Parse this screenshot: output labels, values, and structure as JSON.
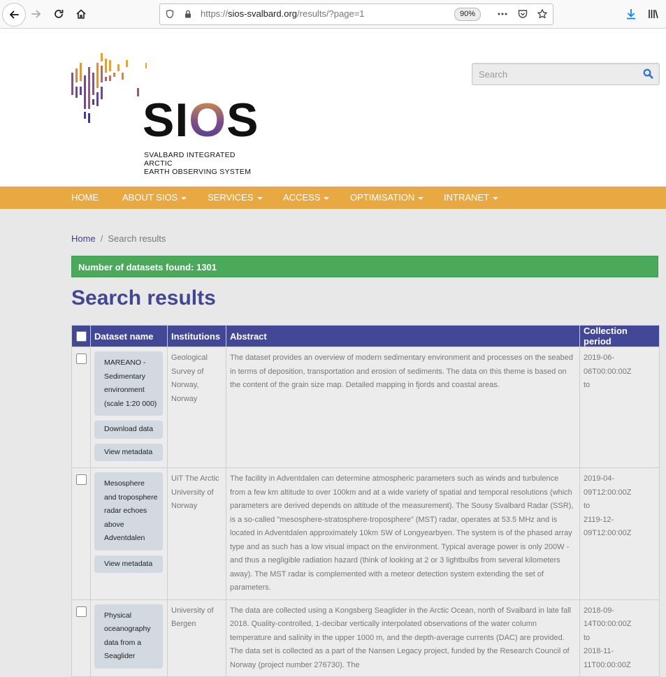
{
  "browser": {
    "url_prefix": "https://",
    "url_host": "sios-svalbard.org",
    "url_path": "/results/?page=1",
    "zoom": "90%"
  },
  "header": {
    "logo_word": "SIOS",
    "logo_sub_line1": "SVALBARD INTEGRATED ARCTIC",
    "logo_sub_line2": "EARTH OBSERVING SYSTEM",
    "search_placeholder": "Search"
  },
  "menu": {
    "items": [
      {
        "label": "HOME"
      },
      {
        "label": "ABOUT SIOS"
      },
      {
        "label": "SERVICES"
      },
      {
        "label": "ACCESS"
      },
      {
        "label": "OPTIMISATION"
      },
      {
        "label": "INTRANET"
      }
    ]
  },
  "breadcrumb": {
    "home": "Home",
    "separator": "/",
    "current": "Search results"
  },
  "alert": {
    "text": "Number of datasets found: 1301"
  },
  "page_title": "Search results",
  "table": {
    "headers": {
      "dataset": "Dataset name",
      "institutions": "Institutions",
      "abstract": "Abstract",
      "period": "Collection period"
    },
    "rows": [
      {
        "name": "MAREANO - Sedimentary environment (scale 1:20 000)",
        "download": "Download data",
        "metadata": "View metadata",
        "institution": "Geological Survey of Norway, Norway",
        "abstract": "The dataset provides an overview of modern sedimentary environment and processes on the seabed in terms of deposition, transportation and erosion of sediments. The data on this theme is based on the content of the grain size map. Detailed mapping in fjords and coastal areas.",
        "period_start": "2019-06-06T00:00:00Z",
        "period_to": "to",
        "period_end": ""
      },
      {
        "name": "Mesosphere and troposphere radar echoes above Adventdalen",
        "metadata": "View metadata",
        "institution": "UiT The Arctic University of Norway",
        "abstract": "The facility in Adventdalen can determine atmospheric parameters such as winds and turbulence from a few km altitude to over 100km and at a wide variety of spatial and temporal resolutions (which parameters are derived depends on altitude of the measurement). The Sousy Svalbard Radar (SSR), is a so-called \"mesosphere-stratosphere-troposphere\" (MST) radar, operates at 53.5 MHz and is located in Adventdalen approximately 10km SW of Longyearbyen. The system is of the phased array type and as such has a low visual impact on the environment. Typical average power is only 200W - and thus a negligible radiation hazard (think of looking at 2 or 3 lightbulbs from several kilometers away). The MST radar is complemented with a meteor detection system extending the set of parameters.",
        "period_start": "2019-04-09T12:00:00Z",
        "period_to": "to",
        "period_end": "2119-12-09T12:00:00Z"
      },
      {
        "name": "Physical oceanography data from a Seaglider",
        "institution": "University of Bergen",
        "abstract": "The data are collected using a Kongsberg Seaglider in the Arctic Ocean, north of Svalbard in late fall 2018. Quality-controlled, 1-decibar vertically interpolated observations of the water column temperature and salinity in the upper 1000 m, and the depth-average currents (DAC) are provided. The data set is collected as a part of the Nansen Legacy project, funded by the Research Council of Norway (project number 276730). The",
        "period_start": "2018-09-14T00:00:00Z",
        "period_to": "to",
        "period_end": "2018-11-11T00:00:00Z"
      }
    ]
  }
}
